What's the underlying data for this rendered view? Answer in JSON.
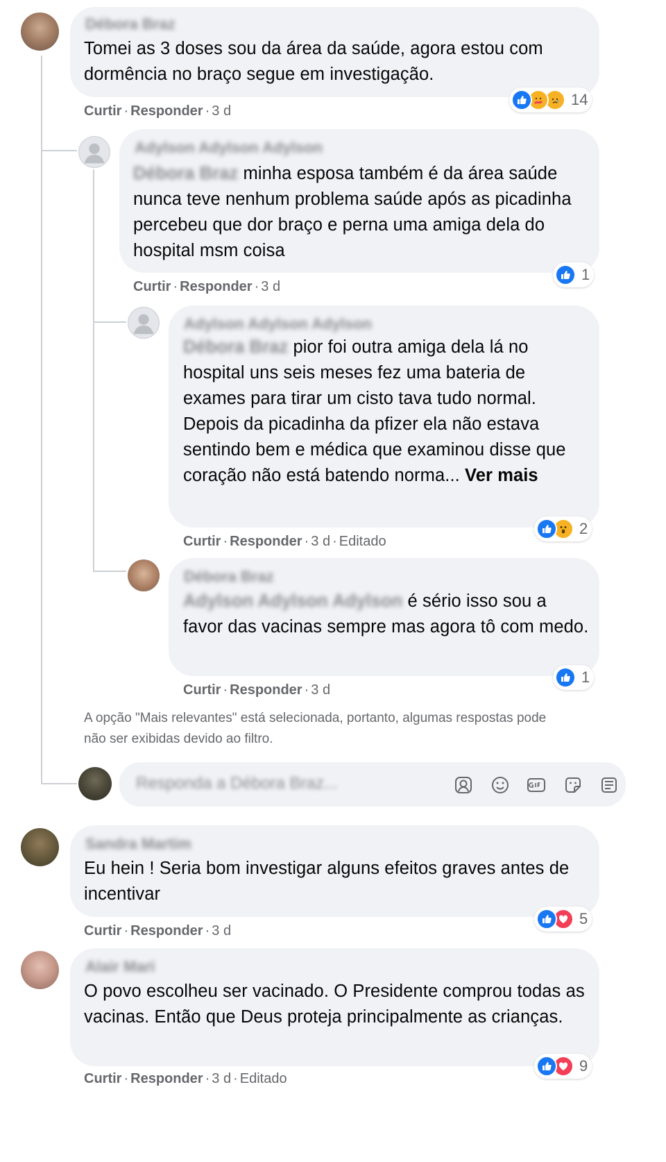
{
  "comments": [
    {
      "author": "Débora Braz",
      "text": "Tomei as 3 doses sou da área da saúde, agora estou com dormência no braço segue em investigação.",
      "react_count": "14",
      "actions": {
        "like": "Curtir",
        "reply": "Responder",
        "time": "3 d"
      }
    },
    {
      "author": "Adylson Adylson Adylson",
      "mention": "Débora Braz",
      "text": "minha esposa também é da área saúde nunca teve nenhum problema saúde após as picadinha percebeu que dor braço e perna uma amiga dela do hospital msm coisa",
      "react_count": "1",
      "actions": {
        "like": "Curtir",
        "reply": "Responder",
        "time": "3 d"
      }
    },
    {
      "author": "Adylson Adylson Adylson",
      "mention": "Débora Braz",
      "text": "pior foi outra amiga dela lá no hospital uns seis meses fez uma bateria de exames para tirar um cisto tava tudo normal. Depois da picadinha da pfizer ela não estava sentindo bem e médica que examinou disse que coração não está batendo norma...",
      "see_more": "Ver mais",
      "react_count": "2",
      "actions": {
        "like": "Curtir",
        "reply": "Responder",
        "time": "3 d",
        "edited": "Editado"
      }
    },
    {
      "author": "Débora Braz",
      "mention": "Adylson Adylson Adylson",
      "text": "é sério isso sou a favor das vacinas sempre mas agora tô com medo.",
      "react_count": "1",
      "actions": {
        "like": "Curtir",
        "reply": "Responder",
        "time": "3 d"
      }
    },
    {
      "author": "Sandra Martim",
      "text": "Eu hein ! Seria bom investigar alguns efeitos graves antes de incentivar",
      "react_count": "5",
      "actions": {
        "like": "Curtir",
        "reply": "Responder",
        "time": "3 d"
      }
    },
    {
      "author": "Alair Mari",
      "text": "O povo escolheu ser vacinado. O Presidente comprou todas as vacinas. Então que Deus proteja principalmente as crianças.",
      "react_count": "9",
      "actions": {
        "like": "Curtir",
        "reply": "Responder",
        "time": "3 d",
        "edited": "Editado"
      }
    }
  ],
  "filter_note": {
    "line1": "A opção \"Mais relevantes\" está selecionada, portanto, algumas respostas pode",
    "line2": "não ser exibidas devido ao filtro."
  },
  "reply_box": {
    "placeholder": "Responda a Débora Braz..."
  },
  "icons": [
    "avatar-sticker-icon",
    "emoji-icon",
    "gif-icon",
    "sticker-icon",
    "more-icon"
  ],
  "colors": {
    "bubble": "#f0f2f5",
    "like": "#1877f2",
    "love": "#f33e58",
    "haha": "#f7b125",
    "muted_text": "#65676b"
  }
}
